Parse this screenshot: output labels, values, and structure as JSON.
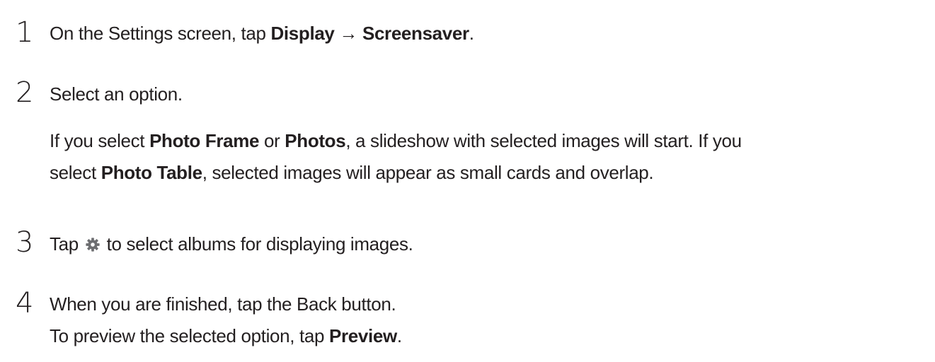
{
  "steps": [
    {
      "number": "1",
      "text": [
        {
          "t": "On the Settings screen, tap "
        },
        {
          "t": "Display",
          "bold": true
        },
        {
          "t": " → "
        },
        {
          "t": "Screensaver",
          "bold": true
        },
        {
          "t": "."
        }
      ]
    },
    {
      "number": "2",
      "text": [
        {
          "t": "Select an option."
        }
      ],
      "details": [
        [
          {
            "t": "If you select "
          },
          {
            "t": "Photo Frame",
            "bold": true
          },
          {
            "t": " or "
          },
          {
            "t": "Photos",
            "bold": true
          },
          {
            "t": ", a slideshow with selected images will start. If you"
          }
        ],
        [
          {
            "t": "select "
          },
          {
            "t": "Photo Table",
            "bold": true
          },
          {
            "t": ", selected images will appear as small cards and overlap."
          }
        ]
      ]
    },
    {
      "number": "3",
      "text": [
        {
          "t": "Tap "
        },
        {
          "icon": "gear-icon"
        },
        {
          "t": " to select albums for displaying images."
        }
      ]
    },
    {
      "number": "4",
      "text": [
        {
          "t": "When you are finished, tap the Back button."
        }
      ],
      "details": [
        [
          {
            "t": "To preview the selected option, tap "
          },
          {
            "t": "Preview",
            "bold": true
          },
          {
            "t": "."
          }
        ]
      ]
    }
  ],
  "colors": {
    "text": "#231f20",
    "icon": "#6d6e71"
  }
}
